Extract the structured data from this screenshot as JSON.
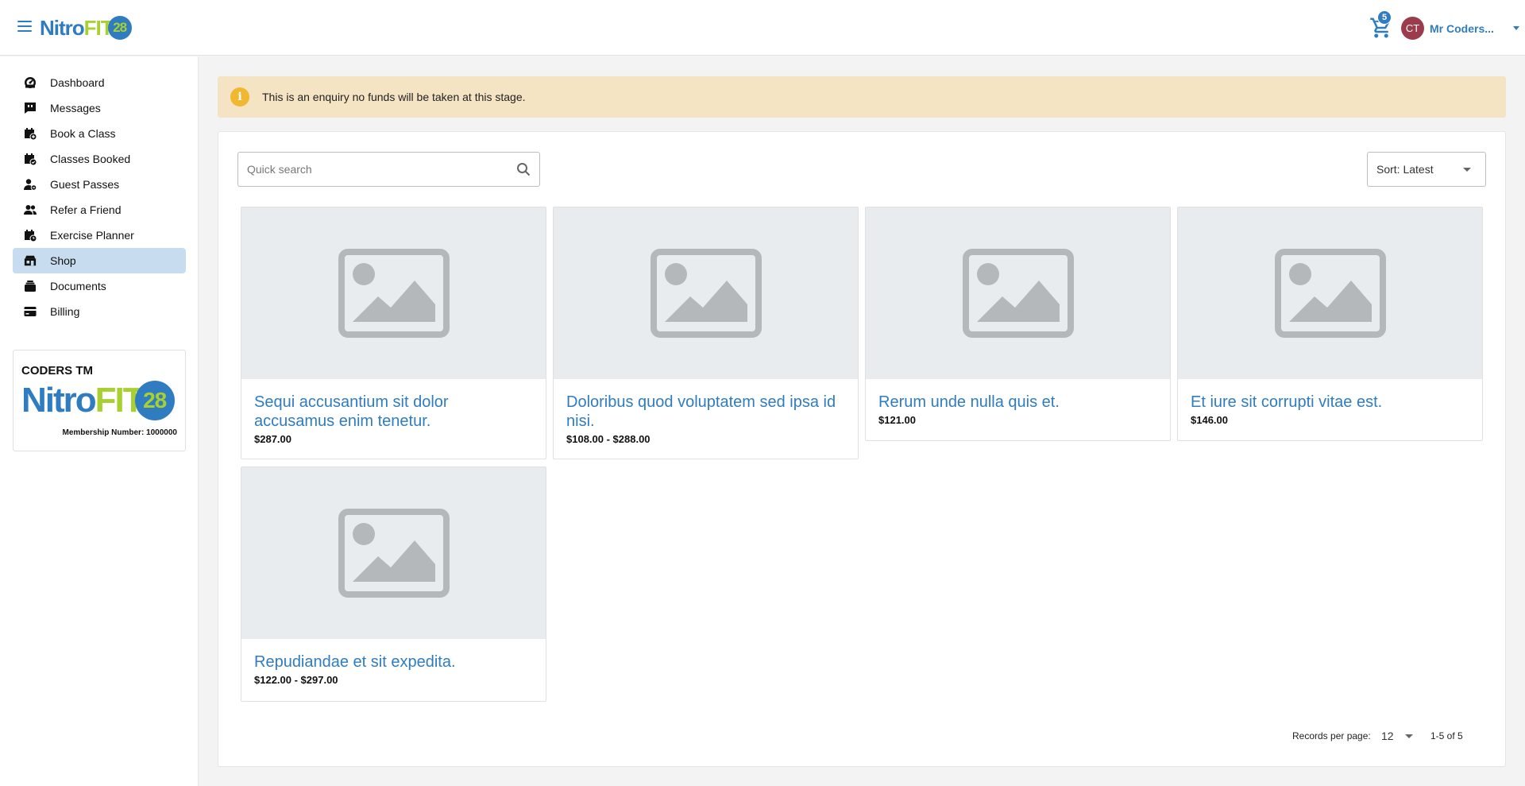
{
  "header": {
    "brand": {
      "nitro": "Nitro",
      "fit": "FIT",
      "num": "28"
    },
    "cart_count": "5",
    "user": {
      "initials": "CT",
      "name": "Mr Coders..."
    }
  },
  "sidebar": {
    "items": [
      {
        "label": "Dashboard",
        "icon": "dashboard-icon"
      },
      {
        "label": "Messages",
        "icon": "message-icon"
      },
      {
        "label": "Book a Class",
        "icon": "calendar-plus-icon"
      },
      {
        "label": "Classes Booked",
        "icon": "calendar-check-icon"
      },
      {
        "label": "Guest Passes",
        "icon": "guest-pass-icon"
      },
      {
        "label": "Refer a Friend",
        "icon": "users-icon"
      },
      {
        "label": "Exercise Planner",
        "icon": "calendar-clock-icon"
      },
      {
        "label": "Shop",
        "icon": "shop-icon"
      },
      {
        "label": "Documents",
        "icon": "documents-icon"
      },
      {
        "label": "Billing",
        "icon": "credit-card-icon"
      }
    ],
    "active_item": "Shop",
    "member_card": {
      "title": "CODERS TM",
      "membership_number": "Membership Number: 1000000"
    }
  },
  "alert": {
    "text": "This is an enquiry no funds will be taken at this stage."
  },
  "toolbar": {
    "search_placeholder": "Quick search",
    "sort_label": "Sort: Latest"
  },
  "products": [
    {
      "title": "Sequi accusantium sit dolor accusamus enim tenetur.",
      "price": "$287.00"
    },
    {
      "title": "Doloribus quod voluptatem sed ipsa id nisi.",
      "price": "$108.00 - $288.00"
    },
    {
      "title": "Rerum unde nulla quis et.",
      "price": "$121.00"
    },
    {
      "title": "Et iure sit corrupti vitae est.",
      "price": "$146.00"
    },
    {
      "title": "Repudiandae et sit expedita.",
      "price": "$122.00 - $297.00"
    }
  ],
  "pagination": {
    "records_label": "Records per page:",
    "per_page": "12",
    "range": "1-5 of 5"
  },
  "colors": {
    "primary": "#2f7cc1",
    "accent_green": "#a7d030",
    "alert_bg": "#f4e4c3",
    "alert_icon": "#f0b731",
    "active_nav": "#c7dcef",
    "avatar": "#9c3b4b"
  }
}
